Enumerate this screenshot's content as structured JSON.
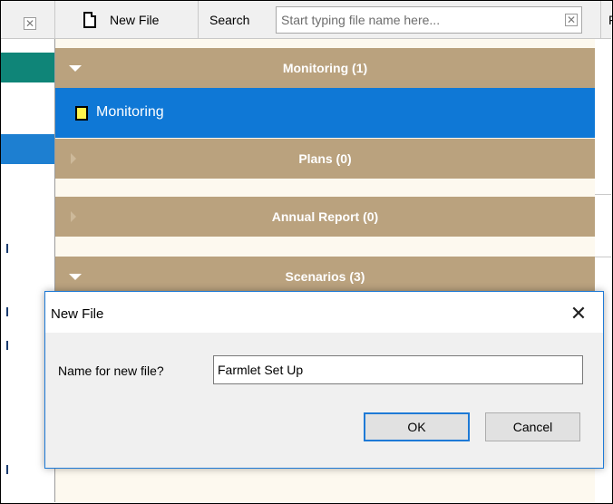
{
  "toolbar": {
    "close_glyph": "✕",
    "new_file_label": "New File",
    "search_label": "Search",
    "search_placeholder": "Start typing file name here...",
    "search_clear_glyph": "✕",
    "overflow_text": "F"
  },
  "groups": [
    {
      "label": "Monitoring (1)",
      "expanded": true,
      "items": [
        {
          "label": "Monitoring",
          "selected": true
        }
      ]
    },
    {
      "label": "Plans (0)",
      "expanded": false
    },
    {
      "label": "Annual Report (0)",
      "expanded": false
    },
    {
      "label": "Scenarios (3)",
      "expanded": true
    }
  ],
  "dialog": {
    "title": "New File",
    "close_glyph": "✕",
    "name_label": "Name for new file?",
    "name_value": "Farmlet Set Up",
    "ok_label": "OK",
    "cancel_label": "Cancel"
  },
  "colors": {
    "group_header": "#baa27e",
    "selected_item": "#0f78d6",
    "sidebar_teal": "#0f8578",
    "sidebar_blue": "#1d7fd1",
    "dialog_border": "#1e7ad6"
  },
  "icons": {
    "new_file": "document-icon",
    "file_item": "file-icon",
    "expanded": "triangle-down-icon",
    "collapsed": "triangle-right-icon"
  }
}
